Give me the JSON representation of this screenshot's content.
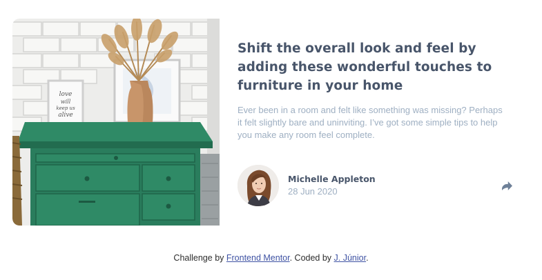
{
  "article": {
    "title": "Shift the overall look and feel by adding these wonderful touches to furniture in your home",
    "description": "Ever been in a room and felt like something was missing? Perhaps it felt slightly bare and uninviting. I’ve got some simple tips to help you make any room feel complete.",
    "image_icon": "drawers-photo",
    "author": {
      "name": "Michelle Appleton",
      "date": "28 Jun 2020",
      "avatar_icon": "avatar-photo"
    },
    "share_icon": "share-icon"
  },
  "attribution": {
    "prefix": "Challenge by ",
    "link1": "Frontend Mentor",
    "middle": ". Coded by ",
    "link2": "J. Júnior",
    "suffix": "."
  },
  "colors": {
    "title": "#48556a",
    "text": "#9eafc2",
    "furniture": "#2e7d5f",
    "link": "#3e52a3"
  }
}
